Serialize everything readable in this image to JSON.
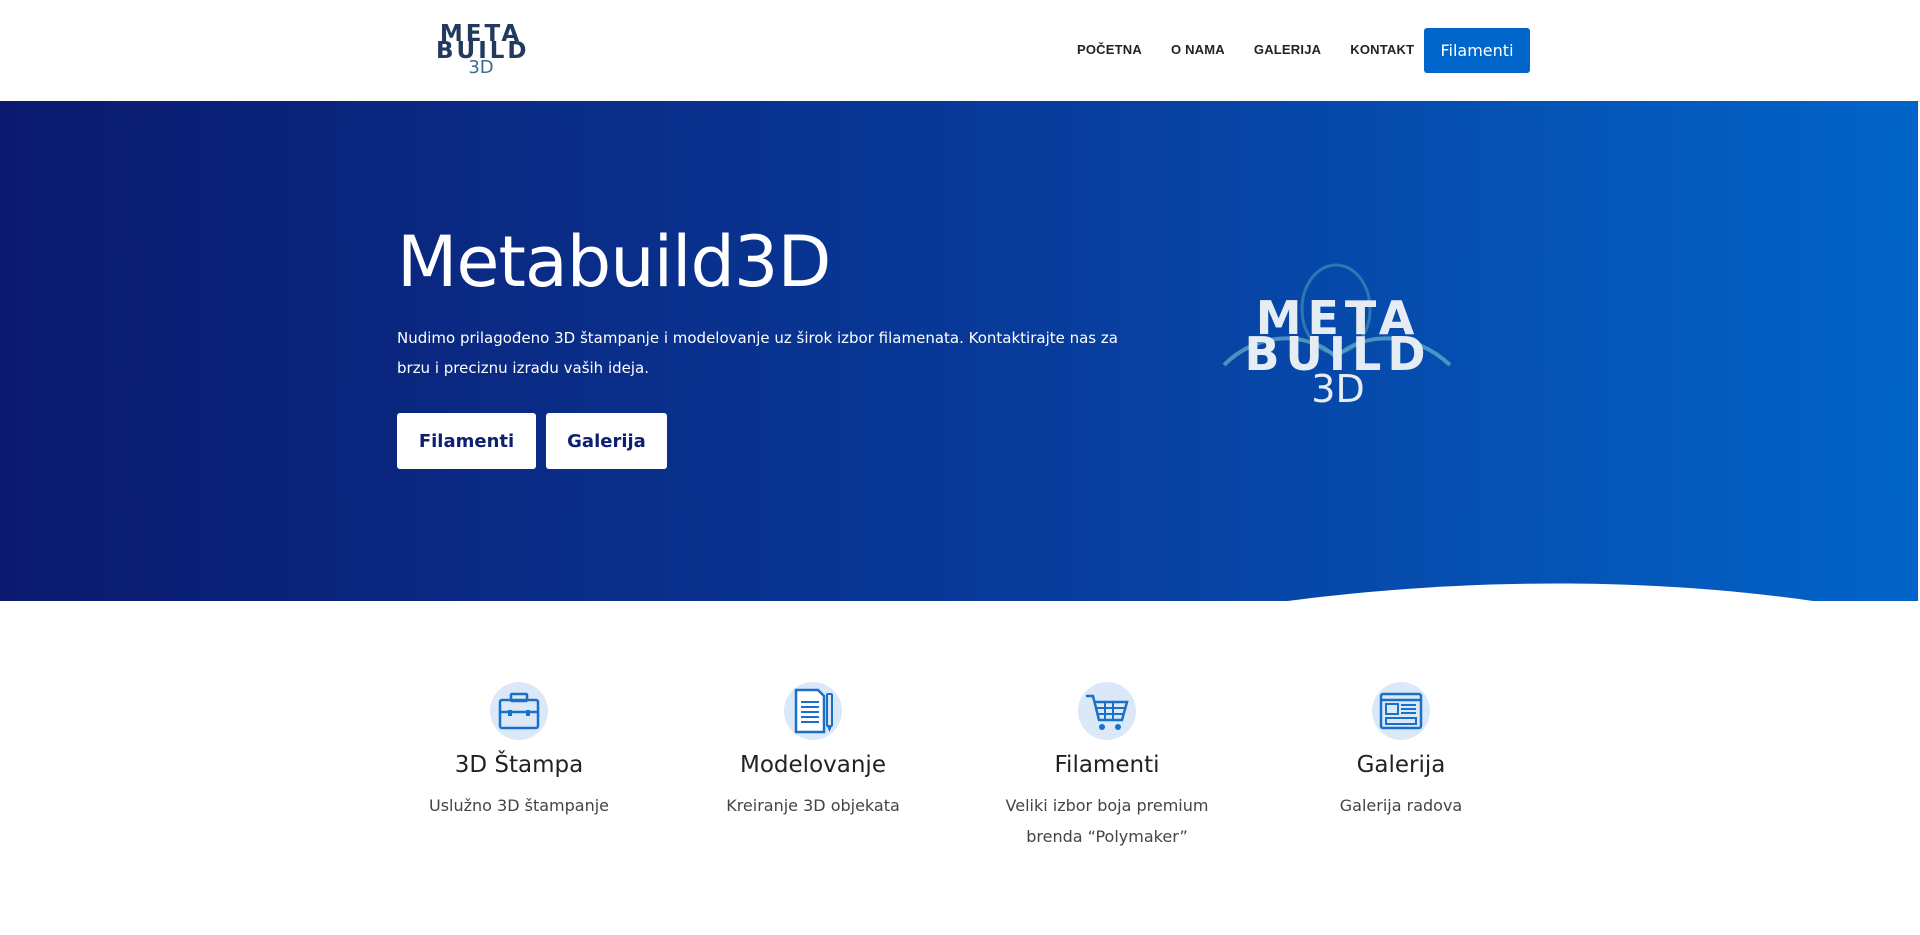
{
  "header": {
    "logo": {
      "line1": "META",
      "line2": "BUILD",
      "line3": "3D"
    },
    "nav": [
      {
        "label": "POČETNA"
      },
      {
        "label": "O NAMA"
      },
      {
        "label": "GALERIJA"
      },
      {
        "label": "KONTAKT"
      }
    ],
    "cta_label": "Filamenti"
  },
  "hero": {
    "title": "Metabuild3D",
    "text": "Nudimo prilagođeno 3D štampanje i modelovanje uz širok izbor filamenata. Kontaktirajte nas za brzu i preciznu izradu vaših ideja.",
    "buttons": [
      {
        "label": "Filamenti"
      },
      {
        "label": "Galerija"
      }
    ],
    "logo": {
      "line1": "META",
      "line2": "BUILD",
      "line3": "3D"
    },
    "colors": {
      "start": "#0b1a6e",
      "end": "#0264c8"
    }
  },
  "features": [
    {
      "icon": "briefcase-icon",
      "title": "3D Štampa",
      "text": "Uslužno 3D štampanje"
    },
    {
      "icon": "document-pencil-icon",
      "title": "Modelovanje",
      "text": "Kreiranje 3D objekata"
    },
    {
      "icon": "shopping-cart-icon",
      "title": "Filamenti",
      "text": "Veliki izbor boja premium brenda “Polymaker”"
    },
    {
      "icon": "browser-window-icon",
      "title": "Galerija",
      "text": "Galerija radova"
    }
  ],
  "colors": {
    "accent": "#0066cc",
    "icon_bg": "#dbe8f8"
  }
}
